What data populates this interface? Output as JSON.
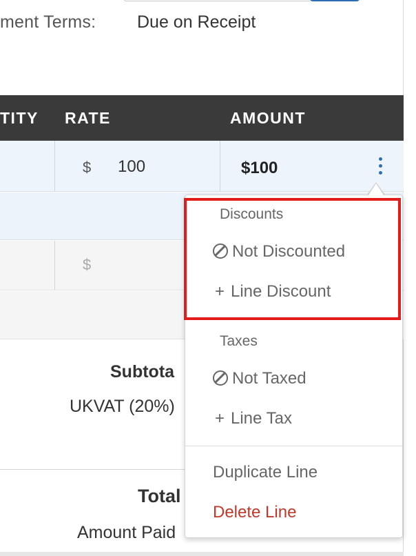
{
  "invoice": {
    "payment_terms_label": "ment Terms:",
    "payment_terms_value": "Due on Receipt"
  },
  "table": {
    "headers": {
      "quantity": "TITY",
      "rate": "RATE",
      "amount": "AMOUNT"
    },
    "line1": {
      "currency": "$",
      "rate": "100",
      "amount": "$100"
    },
    "line2": {
      "currency": "$"
    }
  },
  "totals": {
    "subtotal_label": "Subtota",
    "tax_label": "UKVAT (20%)",
    "total_label": "Total",
    "amount_paid_label": "Amount Paid"
  },
  "menu": {
    "discounts_header": "Discounts",
    "not_discounted": "Not Discounted",
    "line_discount": "Line Discount",
    "taxes_header": "Taxes",
    "not_taxed": "Not Taxed",
    "line_tax": "Line Tax",
    "duplicate_line": "Duplicate Line",
    "delete_line": "Delete Line",
    "plus_symbol": "+"
  },
  "colors": {
    "header_bg": "#3a3a3a",
    "accent": "#2f6eb5",
    "danger": "#c0392b",
    "highlight": "#e31b1b"
  },
  "icons": [
    "kebab-menu-icon",
    "not-allowed-icon",
    "plus-icon"
  ]
}
